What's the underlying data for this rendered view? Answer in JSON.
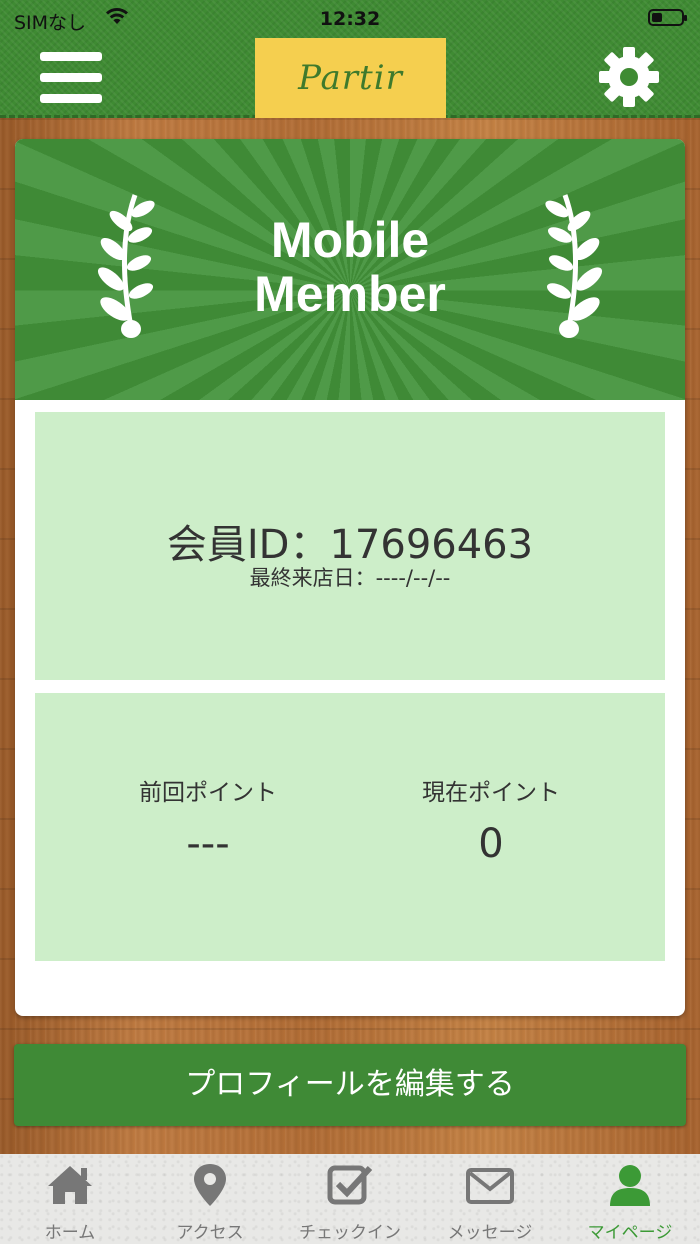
{
  "status_bar": {
    "carrier": "SIMなし",
    "time": "12:32"
  },
  "header": {
    "logo_text": "Partir",
    "menu_icon": "hamburger-icon",
    "settings_icon": "gear-icon"
  },
  "card": {
    "banner_line1": "Mobile",
    "banner_line2": "Member",
    "member_id_text": "会員ID：17696463",
    "last_visit_text": "最終来店日：----/--/--",
    "previous_points_label": "前回ポイント",
    "previous_points_value": "---",
    "current_points_label": "現在ポイント",
    "current_points_value": "0"
  },
  "edit_profile_label": "プロフィールを編集する",
  "tabs": [
    {
      "label": "ホーム",
      "icon": "home-icon",
      "active": false
    },
    {
      "label": "アクセス",
      "icon": "map-pin-icon",
      "active": false
    },
    {
      "label": "チェックイン",
      "icon": "checkbox-icon",
      "active": false
    },
    {
      "label": "メッセージ",
      "icon": "envelope-icon",
      "active": false
    },
    {
      "label": "マイページ",
      "icon": "user-icon",
      "active": true
    }
  ],
  "colors": {
    "header_green": "#3f8b33",
    "logo_yellow": "#f5cf4f",
    "panel_green": "#cdeec9",
    "button_green": "#3f8a36",
    "active_tab": "#3c9a36",
    "inactive_tab": "#777777"
  }
}
